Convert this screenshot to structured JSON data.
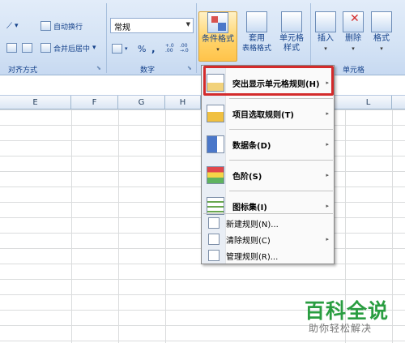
{
  "ribbon": {
    "align_group": {
      "label": "对齐方式",
      "wrap_text": "自动换行",
      "merge_center": "合并后居中",
      "merge_arrow": "▾",
      "orient_arrow": "▾"
    },
    "number_group": {
      "label": "数字",
      "format_value": "常规",
      "percent": "%",
      "comma": ",",
      "dec_increase": "+.0 .00",
      "dec_decrease": ".00 →.0"
    },
    "styles_group": {
      "cond_format": [
        "条件格式",
        "▾"
      ],
      "table_format": [
        "套用",
        "表格格式",
        "▾"
      ],
      "cell_style": [
        "单元格",
        "样式",
        "▾"
      ]
    },
    "cells_group": {
      "label": "单元格",
      "insert": [
        "插入",
        "▾"
      ],
      "delete": [
        "删除",
        "▾"
      ],
      "format": [
        "格式",
        "▾"
      ]
    }
  },
  "columns": [
    "E",
    "F",
    "G",
    "H",
    "L"
  ],
  "menu": {
    "items": [
      {
        "label": "突出显示单元格规则(H)",
        "has_sub": true,
        "icon": "highlight-rules-icon"
      },
      {
        "label": "项目选取规则(T)",
        "has_sub": true,
        "icon": "top-bottom-rules-icon"
      },
      {
        "label": "数据条(D)",
        "has_sub": true,
        "icon": "data-bars-icon"
      },
      {
        "label": "色阶(S)",
        "has_sub": true,
        "icon": "color-scales-icon"
      },
      {
        "label": "图标集(I)",
        "has_sub": true,
        "icon": "icon-sets-icon"
      }
    ],
    "small_items": [
      {
        "label": "新建规则(N)...",
        "has_sub": false
      },
      {
        "label": "清除规则(C)",
        "has_sub": true
      },
      {
        "label": "管理规则(R)...",
        "has_sub": false
      }
    ],
    "sub_arrow": "▸"
  },
  "watermark": {
    "title": "百科全说",
    "subtitle": "助你轻松解决"
  },
  "colors": {
    "highlight_border": "#d42b2b",
    "watermark_green": "#2a9d41",
    "ribbon_bg": "#dbe7f7"
  }
}
